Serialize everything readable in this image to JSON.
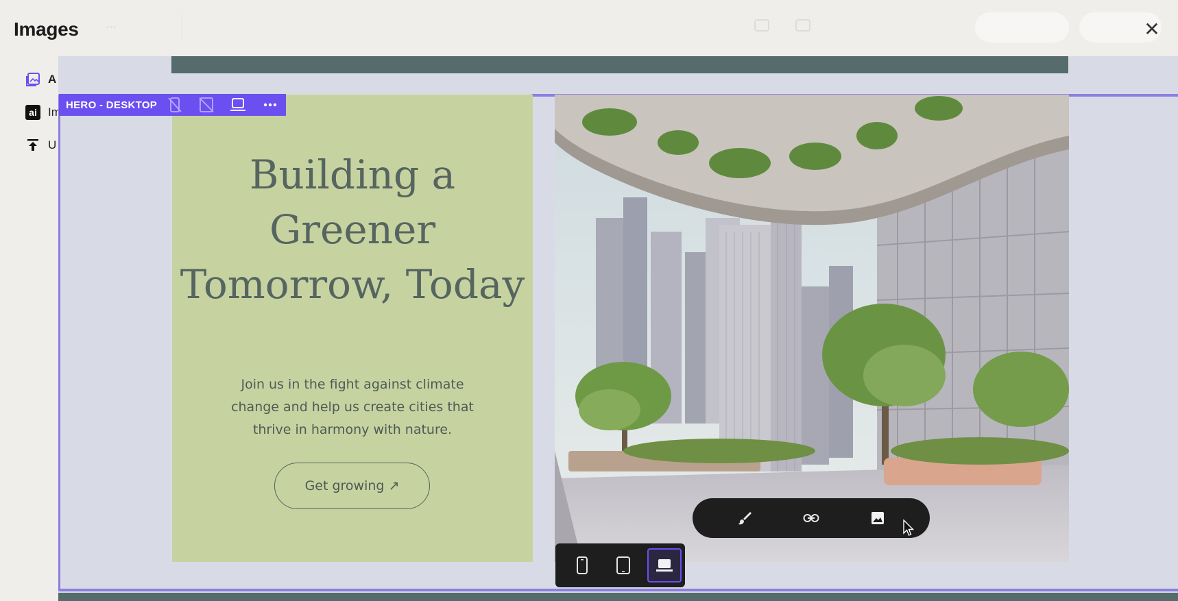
{
  "modal": {
    "title": "Images",
    "close_glyph": "✕"
  },
  "sources": [
    {
      "icon": "image-gallery-icon",
      "label": "A"
    },
    {
      "icon": "ai-badge",
      "badge_text": "ai",
      "label": "Im"
    },
    {
      "icon": "upload-icon",
      "label": "U"
    }
  ],
  "hero_toolbar": {
    "label": "HERO - DESKTOP"
  },
  "hero": {
    "headline": "Building a Greener Tomorrow, Today",
    "subtext": "Join us in the fight against climate change and help us create cities that thrive in harmony with nature.",
    "cta": "Get growing ↗"
  },
  "image_toolbar": [
    "brush-icon",
    "link-icon",
    "image-icon"
  ],
  "device_toolbar": {
    "devices": [
      "mobile",
      "tablet",
      "desktop"
    ],
    "active": "desktop"
  },
  "colors": {
    "accent": "#6b4ff0",
    "green_panel": "#c6d3a0",
    "dark_band": "#566b6b",
    "canvas_bg": "#d8dbe6"
  }
}
